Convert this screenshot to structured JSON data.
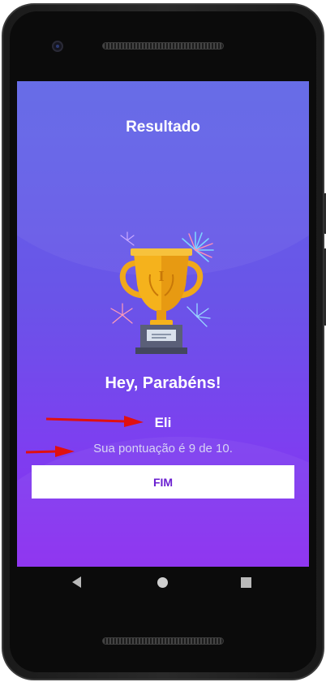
{
  "screen": {
    "title": "Resultado",
    "congrats": "Hey, Parabéns!",
    "player_name": "Eli",
    "score_text": "Sua pontuação é 9 de 10.",
    "finish_label": "FIM"
  },
  "icons": {
    "trophy": "trophy-icon",
    "fireworks": "fireworks-icon",
    "annotation": "red-arrow-icon",
    "nav_back": "back-triangle-icon",
    "nav_home": "home-circle-icon",
    "nav_recent": "recent-square-icon"
  },
  "colors": {
    "gradient_top": "#5f66e6",
    "gradient_bottom": "#8a2cf0",
    "button_text": "#6a1fd0",
    "annotation_arrow": "#e01010",
    "trophy_gold": "#f5b21c"
  }
}
